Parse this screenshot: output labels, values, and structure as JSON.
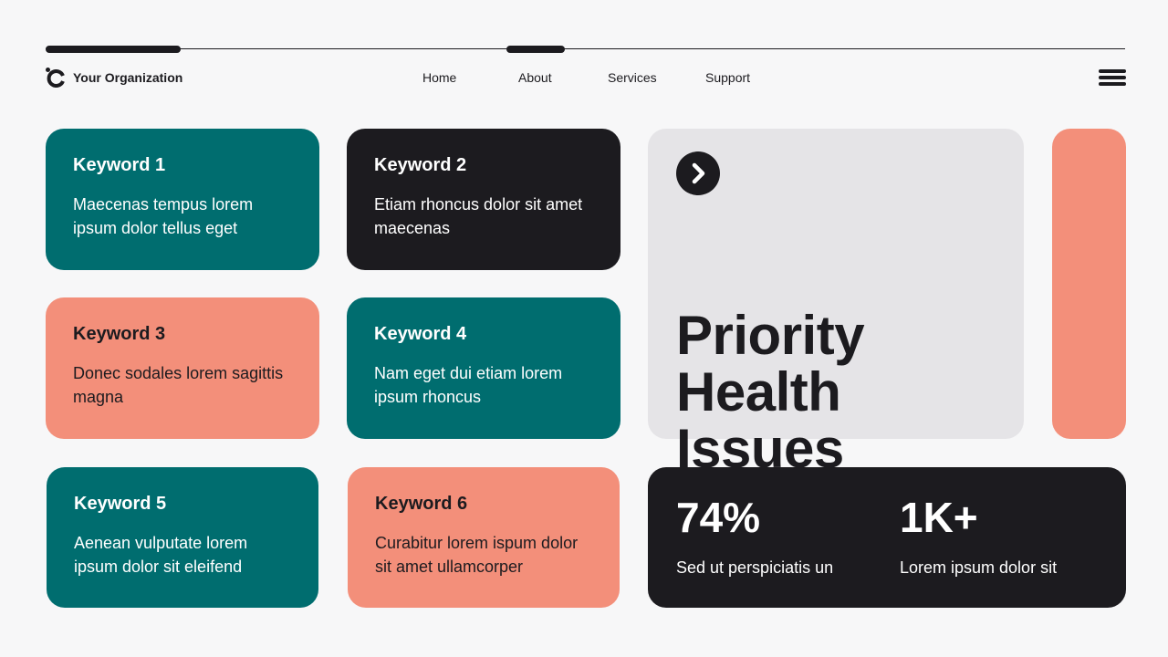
{
  "header": {
    "brand": "Your Organization",
    "nav": [
      "Home",
      "About",
      "Services",
      "Support"
    ]
  },
  "icons": {
    "logo": "organization-logo-icon",
    "menu": "hamburger-menu-icon",
    "arrow": "chevron-right-icon"
  },
  "colors": {
    "teal": "#006d6f",
    "dark": "#1c1b1f",
    "salmon": "#f38f7a",
    "light_gray": "#e5e4e7",
    "background": "#f7f7f8"
  },
  "cards": [
    {
      "title": "Keyword 1",
      "text": "Maecenas tempus lorem ipsum dolor tellus eget"
    },
    {
      "title": "Keyword 2",
      "text": "Etiam rhoncus dolor sit amet maecenas"
    },
    {
      "title": "Keyword 3",
      "text": "Donec sodales lorem sagittis magna"
    },
    {
      "title": "Keyword 4",
      "text": "Nam eget dui etiam lorem ipsum rhoncus"
    },
    {
      "title": "Keyword 5",
      "text": "Aenean vulputate lorem ipsum dolor sit eleifend"
    },
    {
      "title": "Keyword 6",
      "text": "Curabitur lorem ispum dolor sit amet ullamcorper"
    }
  ],
  "feature": {
    "title_line1": "Priority",
    "title_line2": "Health Issues"
  },
  "stats": [
    {
      "value": "74%",
      "label": "Sed ut perspiciatis un"
    },
    {
      "value": "1K+",
      "label": "Lorem ipsum dolor sit"
    }
  ]
}
